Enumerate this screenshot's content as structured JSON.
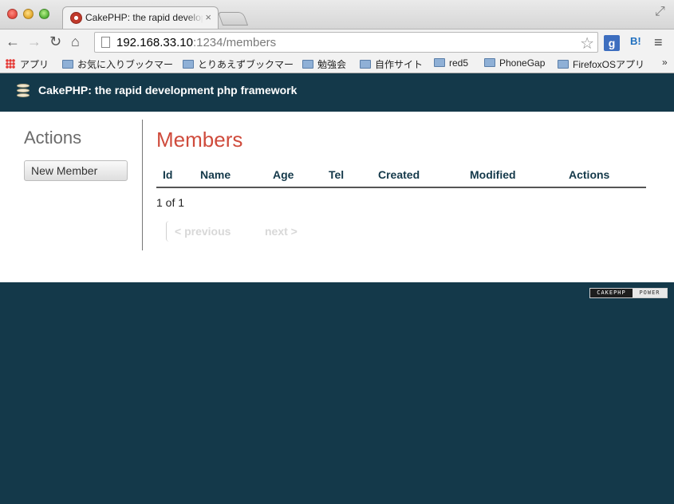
{
  "browser": {
    "tab_title": "CakePHP: the rapid development php framework",
    "tab_close": "×",
    "url_host": "192.168.33.10",
    "url_port_path": ":1234/members",
    "bookmarks": [
      {
        "label": "アプリ",
        "icon": "apps-icon"
      },
      {
        "label": "お気に入りブックマー",
        "icon": "folder-icon"
      },
      {
        "label": "とりあえずブックマー",
        "icon": "folder-icon"
      },
      {
        "label": "勉強会",
        "icon": "folder-icon"
      },
      {
        "label": "自作サイト",
        "icon": "folder-icon"
      },
      {
        "label": "red5",
        "icon": "folder-icon"
      },
      {
        "label": "PhoneGap",
        "icon": "folder-icon"
      },
      {
        "label": "FirefoxOSアプリ",
        "icon": "folder-icon"
      }
    ],
    "bookmarks_overflow": "»",
    "ext_google": "g",
    "ext_hatena": "B!"
  },
  "header": {
    "title": "CakePHP: the rapid development php framework"
  },
  "sidebar": {
    "heading": "Actions",
    "new_member_label": "New Member"
  },
  "main": {
    "title": "Members",
    "columns": [
      "Id",
      "Name",
      "Age",
      "Tel",
      "Created",
      "Modified",
      "Actions"
    ],
    "counter": "1 of 1",
    "prev_label": "< previous",
    "next_label": "next >"
  },
  "footer": {
    "badge_left": "CAKEPHP",
    "badge_right": "POWER"
  },
  "colors": {
    "header_bg": "#14394a",
    "title_red": "#cf4b3c",
    "heading_gray": "#6b6b6b",
    "disabled_link": "#d8d8d8"
  }
}
